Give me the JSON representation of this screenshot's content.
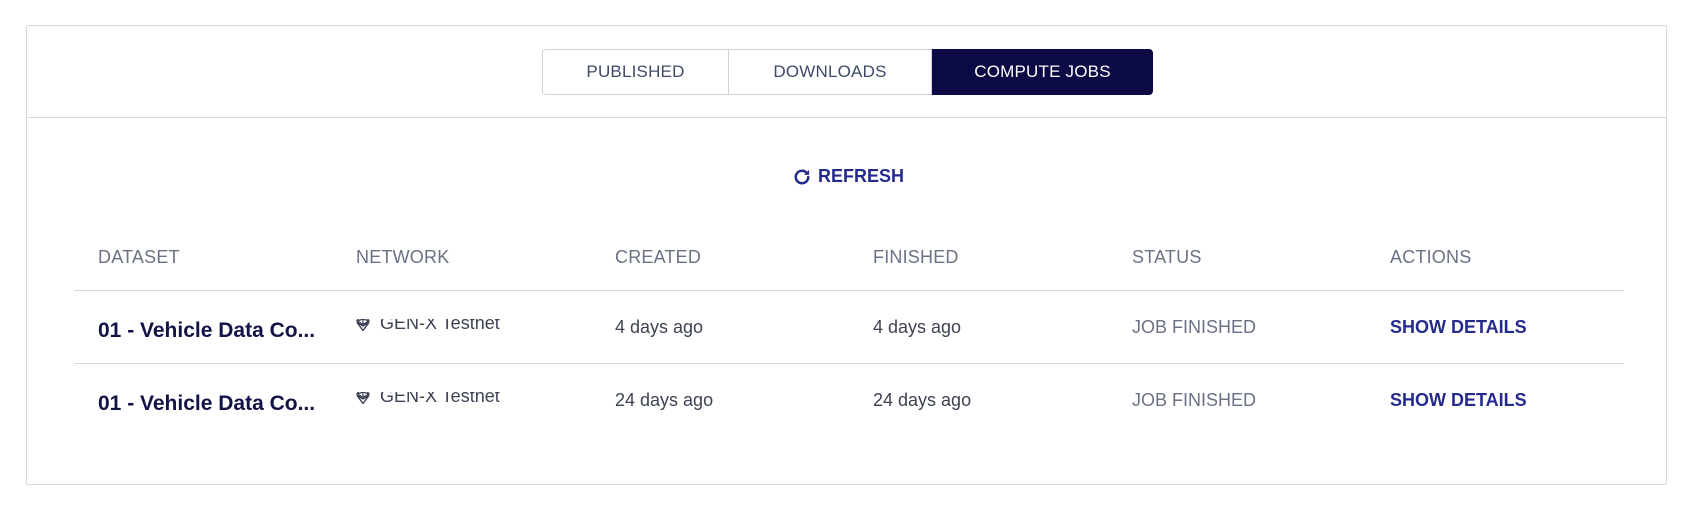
{
  "tabs": [
    {
      "label": "PUBLISHED",
      "active": false
    },
    {
      "label": "DOWNLOADS",
      "active": false
    },
    {
      "label": "COMPUTE JOBS",
      "active": true
    }
  ],
  "refresh": {
    "label": "REFRESH",
    "icon": "refresh-icon"
  },
  "table": {
    "headers": [
      "DATASET",
      "NETWORK",
      "CREATED",
      "FINISHED",
      "STATUS",
      "ACTIONS"
    ],
    "rows": [
      {
        "dataset": "01 - Vehicle Data Co...",
        "network": "GEN-X Testnet",
        "network_icon": "ethereum-icon",
        "created": "4 days ago",
        "finished": "4 days ago",
        "status": "JOB FINISHED",
        "action": "SHOW DETAILS"
      },
      {
        "dataset": "01 - Vehicle Data Co...",
        "network": "GEN-X Testnet",
        "network_icon": "ethereum-icon",
        "created": "24 days ago",
        "finished": "24 days ago",
        "status": "JOB FINISHED",
        "action": "SHOW DETAILS"
      }
    ]
  },
  "colors": {
    "active_tab_bg": "#0b0a44",
    "link": "#252b8c",
    "dataset_text": "#121447",
    "border": "#d6d8de"
  }
}
